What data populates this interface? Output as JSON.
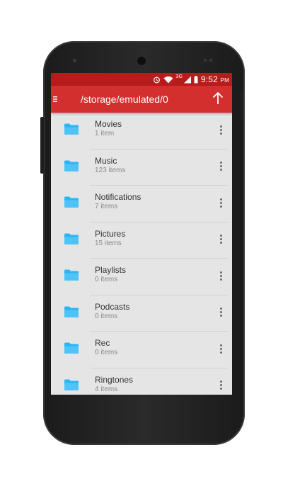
{
  "status_bar": {
    "network": "3G",
    "time": "9:52",
    "ampm": "PM"
  },
  "toolbar": {
    "path": "/storage/emulated/0",
    "menu_icon": "hamburger-menu-icon",
    "up_icon": "arrow-up-icon"
  },
  "colors": {
    "status_bar": "#b71c1c",
    "toolbar": "#d32f2f",
    "folder": "#29b6f6",
    "list_bg": "#e5e5e5"
  },
  "folders": [
    {
      "name": "Movies",
      "count": "1 item"
    },
    {
      "name": "Music",
      "count": "123 items"
    },
    {
      "name": "Notifications",
      "count": "7 items"
    },
    {
      "name": "Pictures",
      "count": "15 items"
    },
    {
      "name": "Playlists",
      "count": "0 items"
    },
    {
      "name": "Podcasts",
      "count": "0 items"
    },
    {
      "name": "Rec",
      "count": "0 items"
    },
    {
      "name": "Ringtones",
      "count": "4 items"
    }
  ]
}
